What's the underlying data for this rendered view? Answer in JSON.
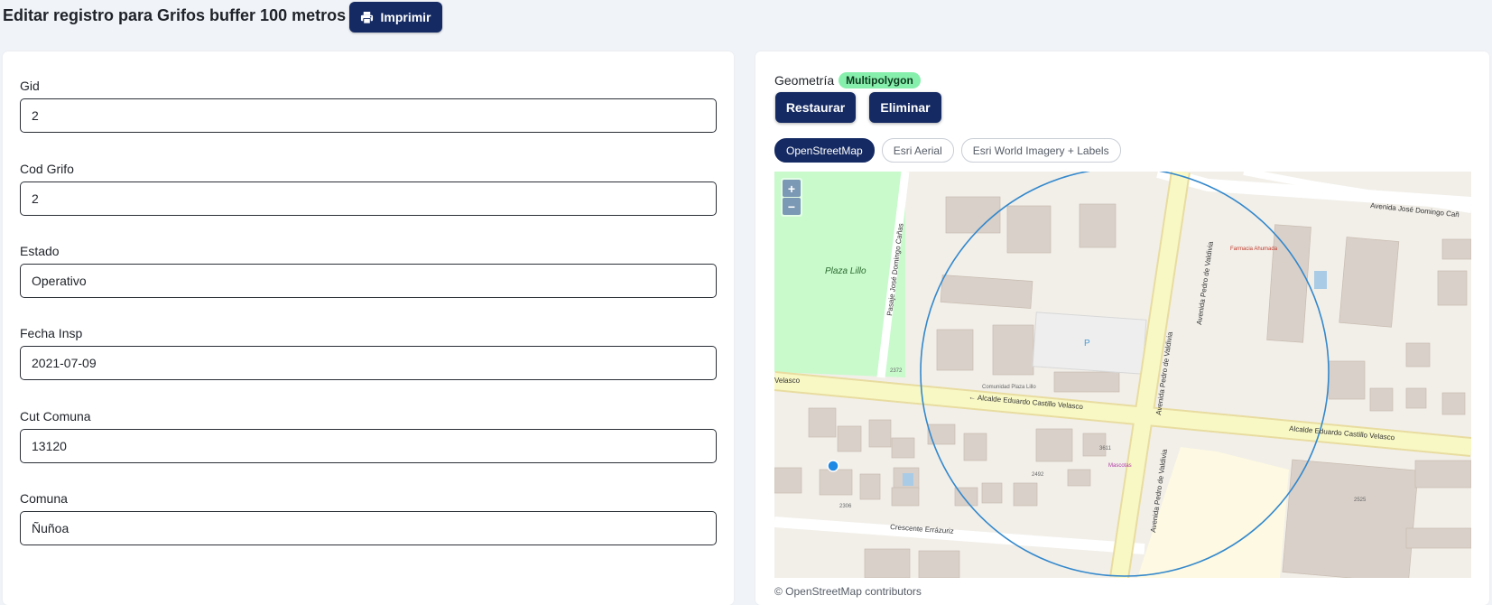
{
  "header": {
    "title": "Editar registro para Grifos buffer 100 metros",
    "print_label": "Imprimir"
  },
  "form": {
    "fields": [
      {
        "label": "Gid",
        "value": "2"
      },
      {
        "label": "Cod Grifo",
        "value": "2"
      },
      {
        "label": "Estado",
        "value": "Operativo"
      },
      {
        "label": "Fecha Insp",
        "value": "2021-07-09"
      },
      {
        "label": "Cut Comuna",
        "value": "13120"
      },
      {
        "label": "Comuna",
        "value": "Ñuñoa"
      }
    ]
  },
  "geometry": {
    "label": "Geometría",
    "type_badge": "Multipolygon",
    "restore_label": "Restaurar",
    "delete_label": "Eliminar"
  },
  "layers": [
    {
      "label": "OpenStreetMap",
      "active": true
    },
    {
      "label": "Esri Aerial",
      "active": false
    },
    {
      "label": "Esri World Imagery + Labels",
      "active": false
    }
  ],
  "map": {
    "zoom_in": "+",
    "zoom_out": "−",
    "labels": {
      "plaza": "Plaza Lillo",
      "pasaje": "Pasaje José Domingo Cañas",
      "av_pedro_n": "Avenida Pedro de Valdivia",
      "av_pedro_s": "Avenida Pedro de Valdivia",
      "av_jose": "Avenida José Domingo Cañ",
      "alcalde_w": "← Alcalde Eduardo Castillo Velasco",
      "alcalde_e": "Alcalde Eduardo Castillo Velasco",
      "velasco": "Velasco",
      "crescente": "Crescente Errázuriz",
      "farmacia": "Farmacia Ahumada",
      "parking": "P",
      "comunidad": "Comunidad Plaza Lillo",
      "mascotas": "Mascotas",
      "num_2525": "2525",
      "num_2492": "2492",
      "num_2306": "2306",
      "num_2372": "2372",
      "num_3611": "3611"
    },
    "colors": {
      "buffer": "#3388cc",
      "road_major": "#f8f8c5",
      "park": "#c8facc",
      "marker": "#1e88e5"
    }
  },
  "attribution": "© OpenStreetMap contributors"
}
